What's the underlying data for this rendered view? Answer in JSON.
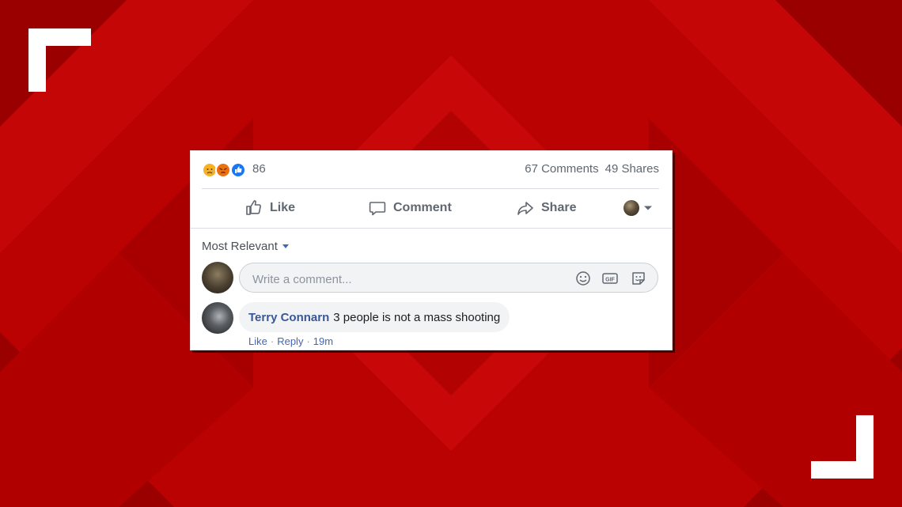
{
  "post": {
    "reactions": {
      "count": "86",
      "types": [
        "sad",
        "angry",
        "like"
      ]
    },
    "stats": {
      "comments": "67 Comments",
      "shares": "49 Shares"
    },
    "actions": {
      "like": "Like",
      "comment": "Comment",
      "share": "Share"
    }
  },
  "comments_section": {
    "sort_label": "Most Relevant",
    "composer": {
      "placeholder": "Write a comment..."
    },
    "comments": [
      {
        "author": "Terry Connarn",
        "text": "3 people is not a mass shooting",
        "like_label": "Like",
        "reply_label": "Reply",
        "time": "19m"
      }
    ]
  },
  "icons": [
    "like-icon",
    "comment-icon",
    "share-icon",
    "emoji-icon",
    "gif-icon",
    "sticker-icon",
    "chevron-down-icon"
  ],
  "colors": {
    "background": "#b80000",
    "link": "#385898",
    "meta_link": "#4267b2",
    "like_reaction": "#1877f2",
    "angry_reaction": "#e9710f",
    "sad_reaction": "#f7b125"
  }
}
